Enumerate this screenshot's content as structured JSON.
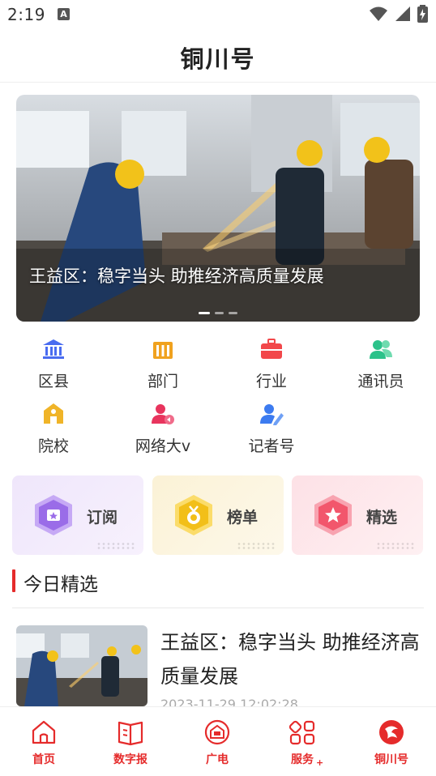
{
  "status_bar": {
    "time": "2:19",
    "notification_badge": "A"
  },
  "header": {
    "title": "铜川号"
  },
  "banner": {
    "caption": "王益区：稳字当头 助推经济高质量发展",
    "slide_count": 3,
    "active_slide": 1
  },
  "categories": [
    {
      "label": "区县",
      "icon": "government-building-icon",
      "color": "#4a6cf0"
    },
    {
      "label": "部门",
      "icon": "pillars-icon",
      "color": "#f0a21f"
    },
    {
      "label": "行业",
      "icon": "briefcase-icon",
      "color": "#f2474a"
    },
    {
      "label": "通讯员",
      "icon": "users-icon",
      "color": "#2cc28a"
    },
    {
      "label": "院校",
      "icon": "school-icon",
      "color": "#f0b428"
    },
    {
      "label": "网络大v",
      "icon": "influencer-icon",
      "color": "#e8345d"
    },
    {
      "label": "记者号",
      "icon": "reporter-icon",
      "color": "#3c7bf0"
    }
  ],
  "features": [
    {
      "label": "订阅",
      "icon": "subscribe-icon",
      "color": "#9a6ce8"
    },
    {
      "label": "榜单",
      "icon": "ranking-icon",
      "color": "#f2bf19"
    },
    {
      "label": "精选",
      "icon": "featured-icon",
      "color": "#f2566c"
    }
  ],
  "section": {
    "title": "今日精选"
  },
  "article": {
    "title": "王益区：稳字当头 助推经济高质量发展",
    "time": "2023-11-29 12:02:28"
  },
  "tabs": [
    {
      "label": "首页",
      "icon": "home-icon"
    },
    {
      "label": "数字报",
      "icon": "newspaper-icon"
    },
    {
      "label": "广电",
      "icon": "tv-icon"
    },
    {
      "label": "服务",
      "icon": "services-grid-icon"
    },
    {
      "label": "铜川号",
      "icon": "tongchuan-logo-icon"
    }
  ],
  "colors": {
    "accent": "#e52b2b"
  }
}
